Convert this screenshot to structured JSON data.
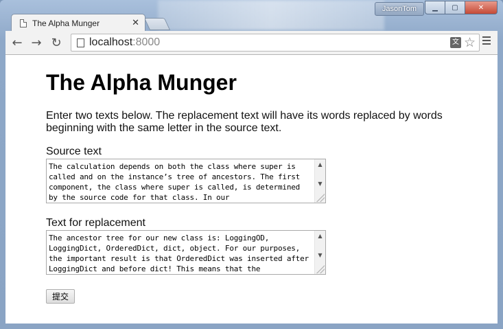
{
  "window": {
    "user_badge": "JasonTom",
    "controls": {
      "minimize": "▁",
      "maximize": "▢",
      "close": "✕"
    }
  },
  "tab": {
    "title": "The Alpha Munger",
    "close_glyph": "✕"
  },
  "toolbar": {
    "back_glyph": "←",
    "forward_glyph": "→",
    "reload_glyph": "↻",
    "url_host": "localhost",
    "url_port": ":8000",
    "translate_glyph": "文",
    "star_glyph": "☆"
  },
  "page": {
    "heading": "The Alpha Munger",
    "intro": "Enter two texts below. The replacement text will have its words replaced by words beginning with the same letter in the source text.",
    "source_label": "Source text",
    "source_value": "The calculation depends on both the class where super is called and on the instance’s tree of ancestors. The first component, the class where super is called, is determined by the source code for that class. In our",
    "replace_label": "Text for replacement",
    "replace_value": "The ancestor tree for our new class is: LoggingOD, LoggingDict, OrderedDict, dict, object. For our purposes, the important result is that OrderedDict was inserted after LoggingDict and before dict! This means that the",
    "submit_label": "提交",
    "scroll_up": "▲",
    "scroll_down": "▼"
  }
}
